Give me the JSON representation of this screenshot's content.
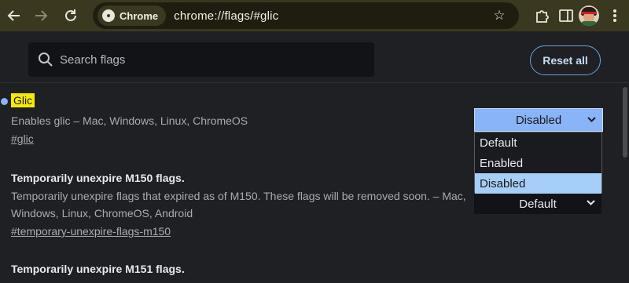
{
  "browser": {
    "chip_label": "Chrome",
    "url": "chrome://flags/#glic"
  },
  "flags": {
    "search_placeholder": "Search flags",
    "reset_label": "Reset all"
  },
  "experiments": [
    {
      "title": "Glic",
      "description": "Enables glic – Mac, Windows, Linux, ChromeOS",
      "link": "#glic",
      "select": {
        "value": "Disabled",
        "options": [
          "Default",
          "Enabled",
          "Disabled"
        ],
        "selected_option": "Disabled"
      }
    },
    {
      "title": "Temporarily unexpire M150 flags.",
      "description_line1": "Temporarily unexpire flags that expired as of M150. These flags will be removed soon. – Mac,",
      "description_line2": "Windows, Linux, ChromeOS, Android",
      "link": "#temporary-unexpire-flags-m150",
      "select": {
        "value": "Default"
      }
    },
    {
      "title": "Temporarily unexpire M151 flags."
    }
  ],
  "colors": {
    "highlight": "#f7e900",
    "accent": "#8ab4f8",
    "selected_option": "#a7cdf9"
  }
}
